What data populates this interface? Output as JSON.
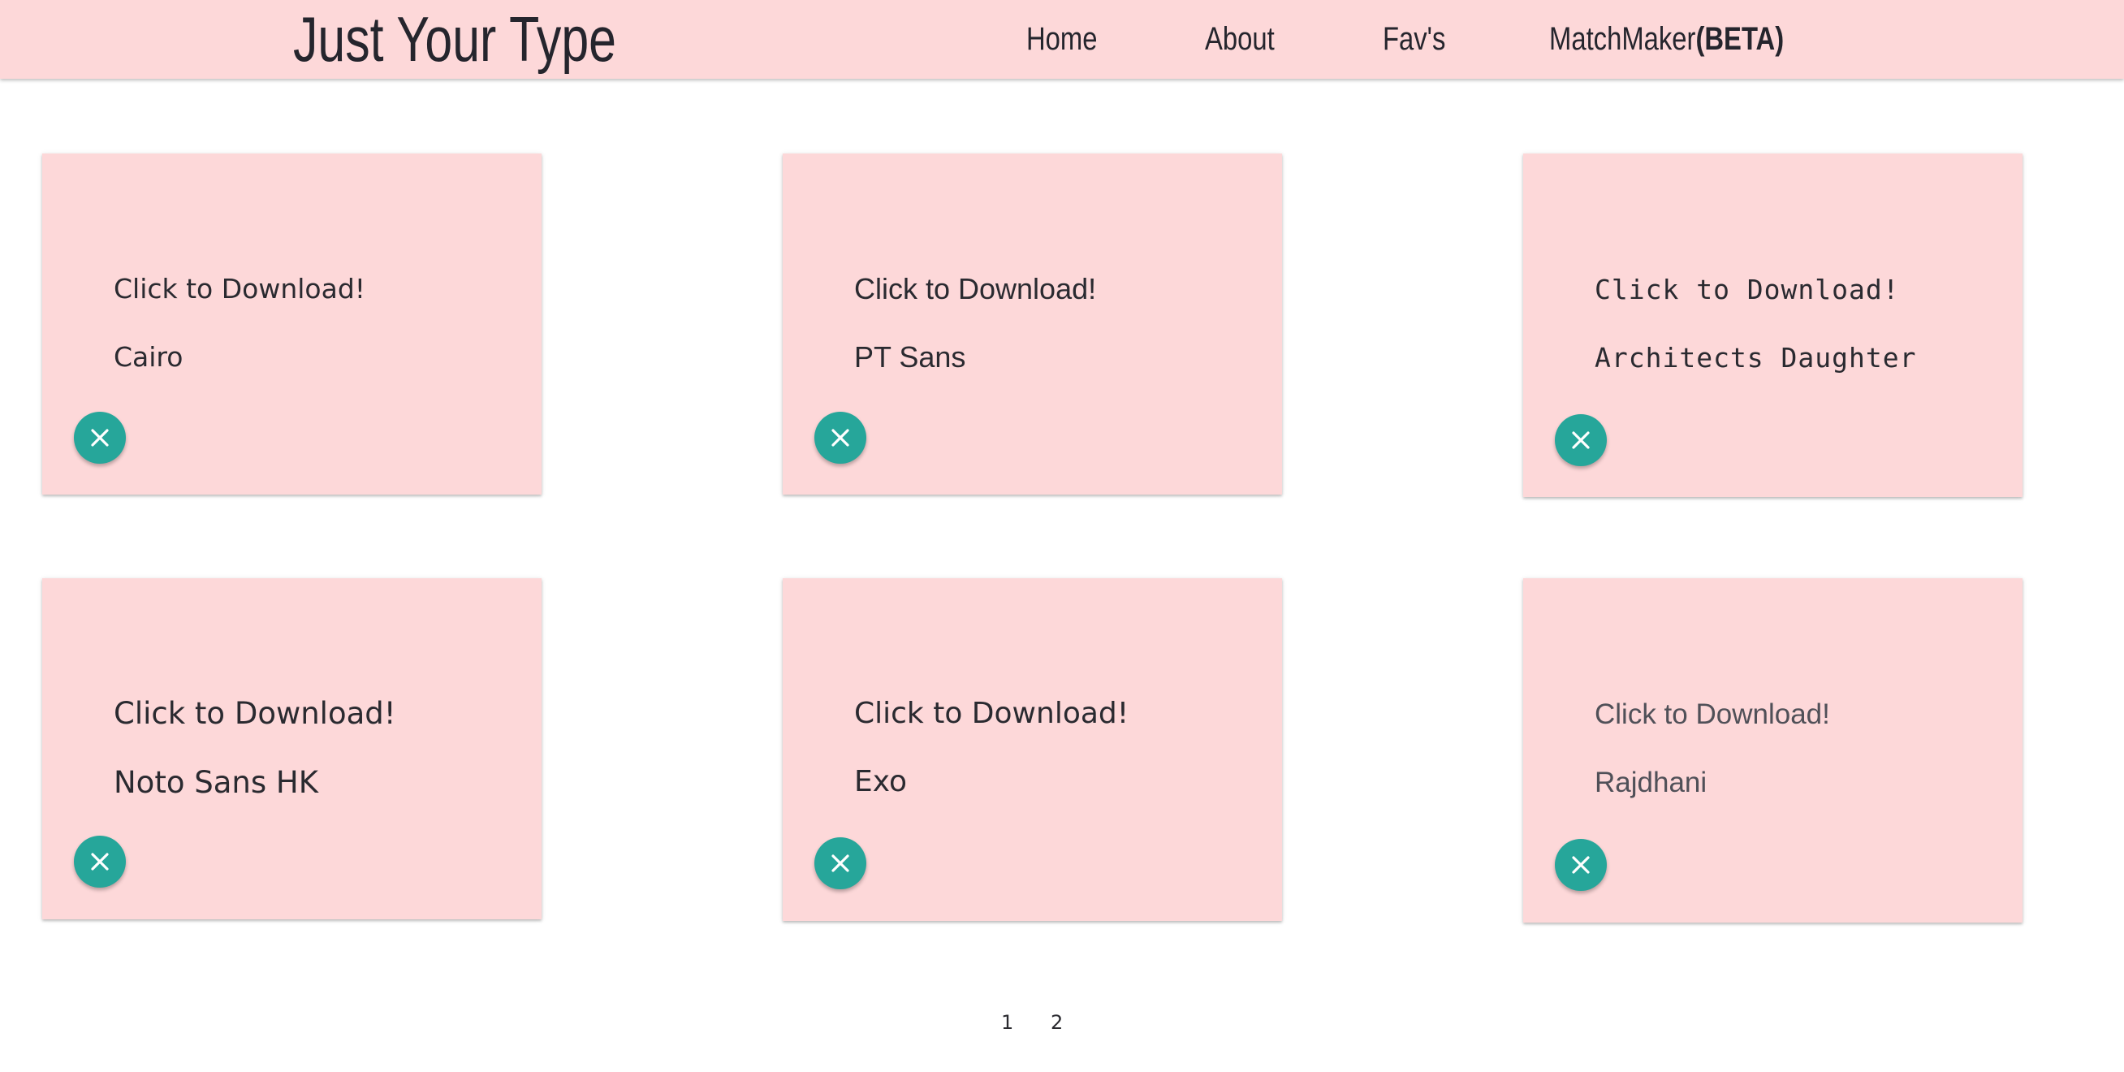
{
  "header": {
    "brand": "Just Your Type",
    "nav": [
      {
        "label": "Home"
      },
      {
        "label": "About"
      },
      {
        "label": "Fav's"
      },
      {
        "label": "MatchMaker",
        "suffix": "(BETA)"
      }
    ]
  },
  "cards": [
    {
      "prompt": "Click to Download!",
      "font_name": "Cairo"
    },
    {
      "prompt": "Click to Download!",
      "font_name": "PT Sans"
    },
    {
      "prompt": "Click to Download!",
      "font_name": "Architects Daughter"
    },
    {
      "prompt": "Click to Download!",
      "font_name": "Noto Sans HK"
    },
    {
      "prompt": "Click to Download!",
      "font_name": "Exo"
    },
    {
      "prompt": "Click to Download!",
      "font_name": "Rajdhani"
    }
  ],
  "card_action_icon": "close-icon",
  "pagination": [
    "1",
    "2"
  ],
  "colors": {
    "header_bg": "#fdd8d9",
    "card_bg": "#fdd8d9",
    "accent": "#26a69a",
    "text": "#25252d"
  }
}
